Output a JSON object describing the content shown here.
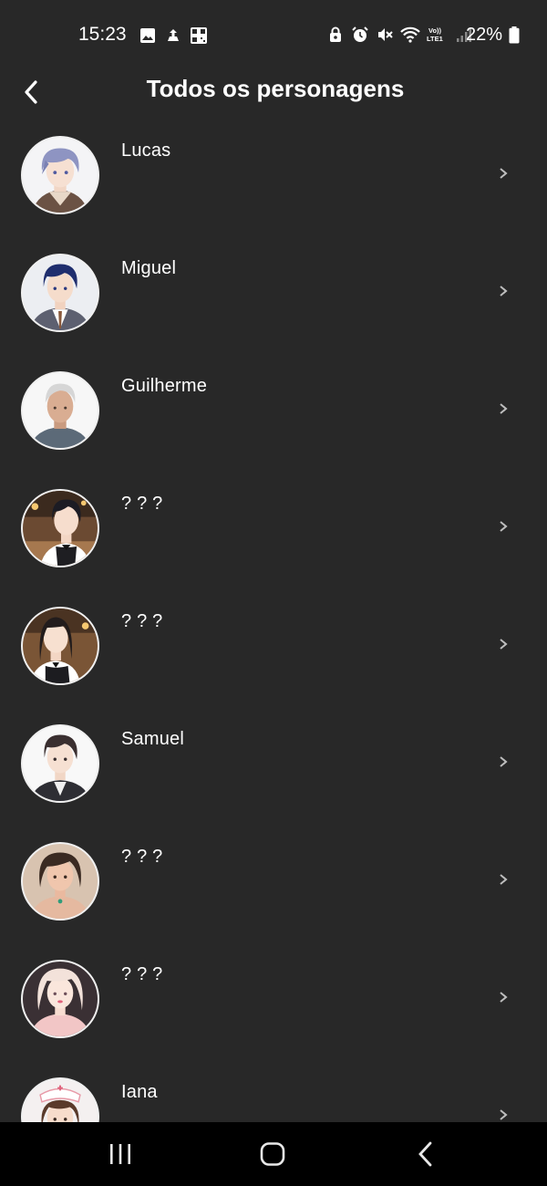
{
  "status_bar": {
    "time": "15:23",
    "battery_percent": "22%",
    "battery_level": 0.22,
    "left_icons": [
      "gallery-icon",
      "cloud-upload-icon",
      "qr-code-icon"
    ],
    "right_icons": [
      "lock-icon",
      "alarm-icon",
      "mute-icon",
      "wifi-icon",
      "volte-lte-icon",
      "signal-icon"
    ]
  },
  "header": {
    "title": "Todos os personagens",
    "back_icon": "chevron-left-icon"
  },
  "characters": [
    {
      "name": "Lucas",
      "avatar": "lucas-avatar"
    },
    {
      "name": "Miguel",
      "avatar": "miguel-avatar"
    },
    {
      "name": "Guilherme",
      "avatar": "guilherme-avatar"
    },
    {
      "name": "? ? ?",
      "avatar": "unknown-bartender-avatar"
    },
    {
      "name": "? ? ?",
      "avatar": "unknown-waitress-avatar"
    },
    {
      "name": "Samuel",
      "avatar": "samuel-avatar"
    },
    {
      "name": "? ? ?",
      "avatar": "unknown-woman-avatar"
    },
    {
      "name": "? ? ?",
      "avatar": "unknown-blonde-avatar"
    },
    {
      "name": "Iana",
      "avatar": "iana-avatar"
    }
  ],
  "nav_bar": {
    "icons": [
      "recent-apps-icon",
      "home-icon",
      "back-icon"
    ]
  },
  "colors": {
    "background": "#282828",
    "text": "#ffffff",
    "chevron": "#bdbdbd",
    "nav_bar": "#000000"
  }
}
